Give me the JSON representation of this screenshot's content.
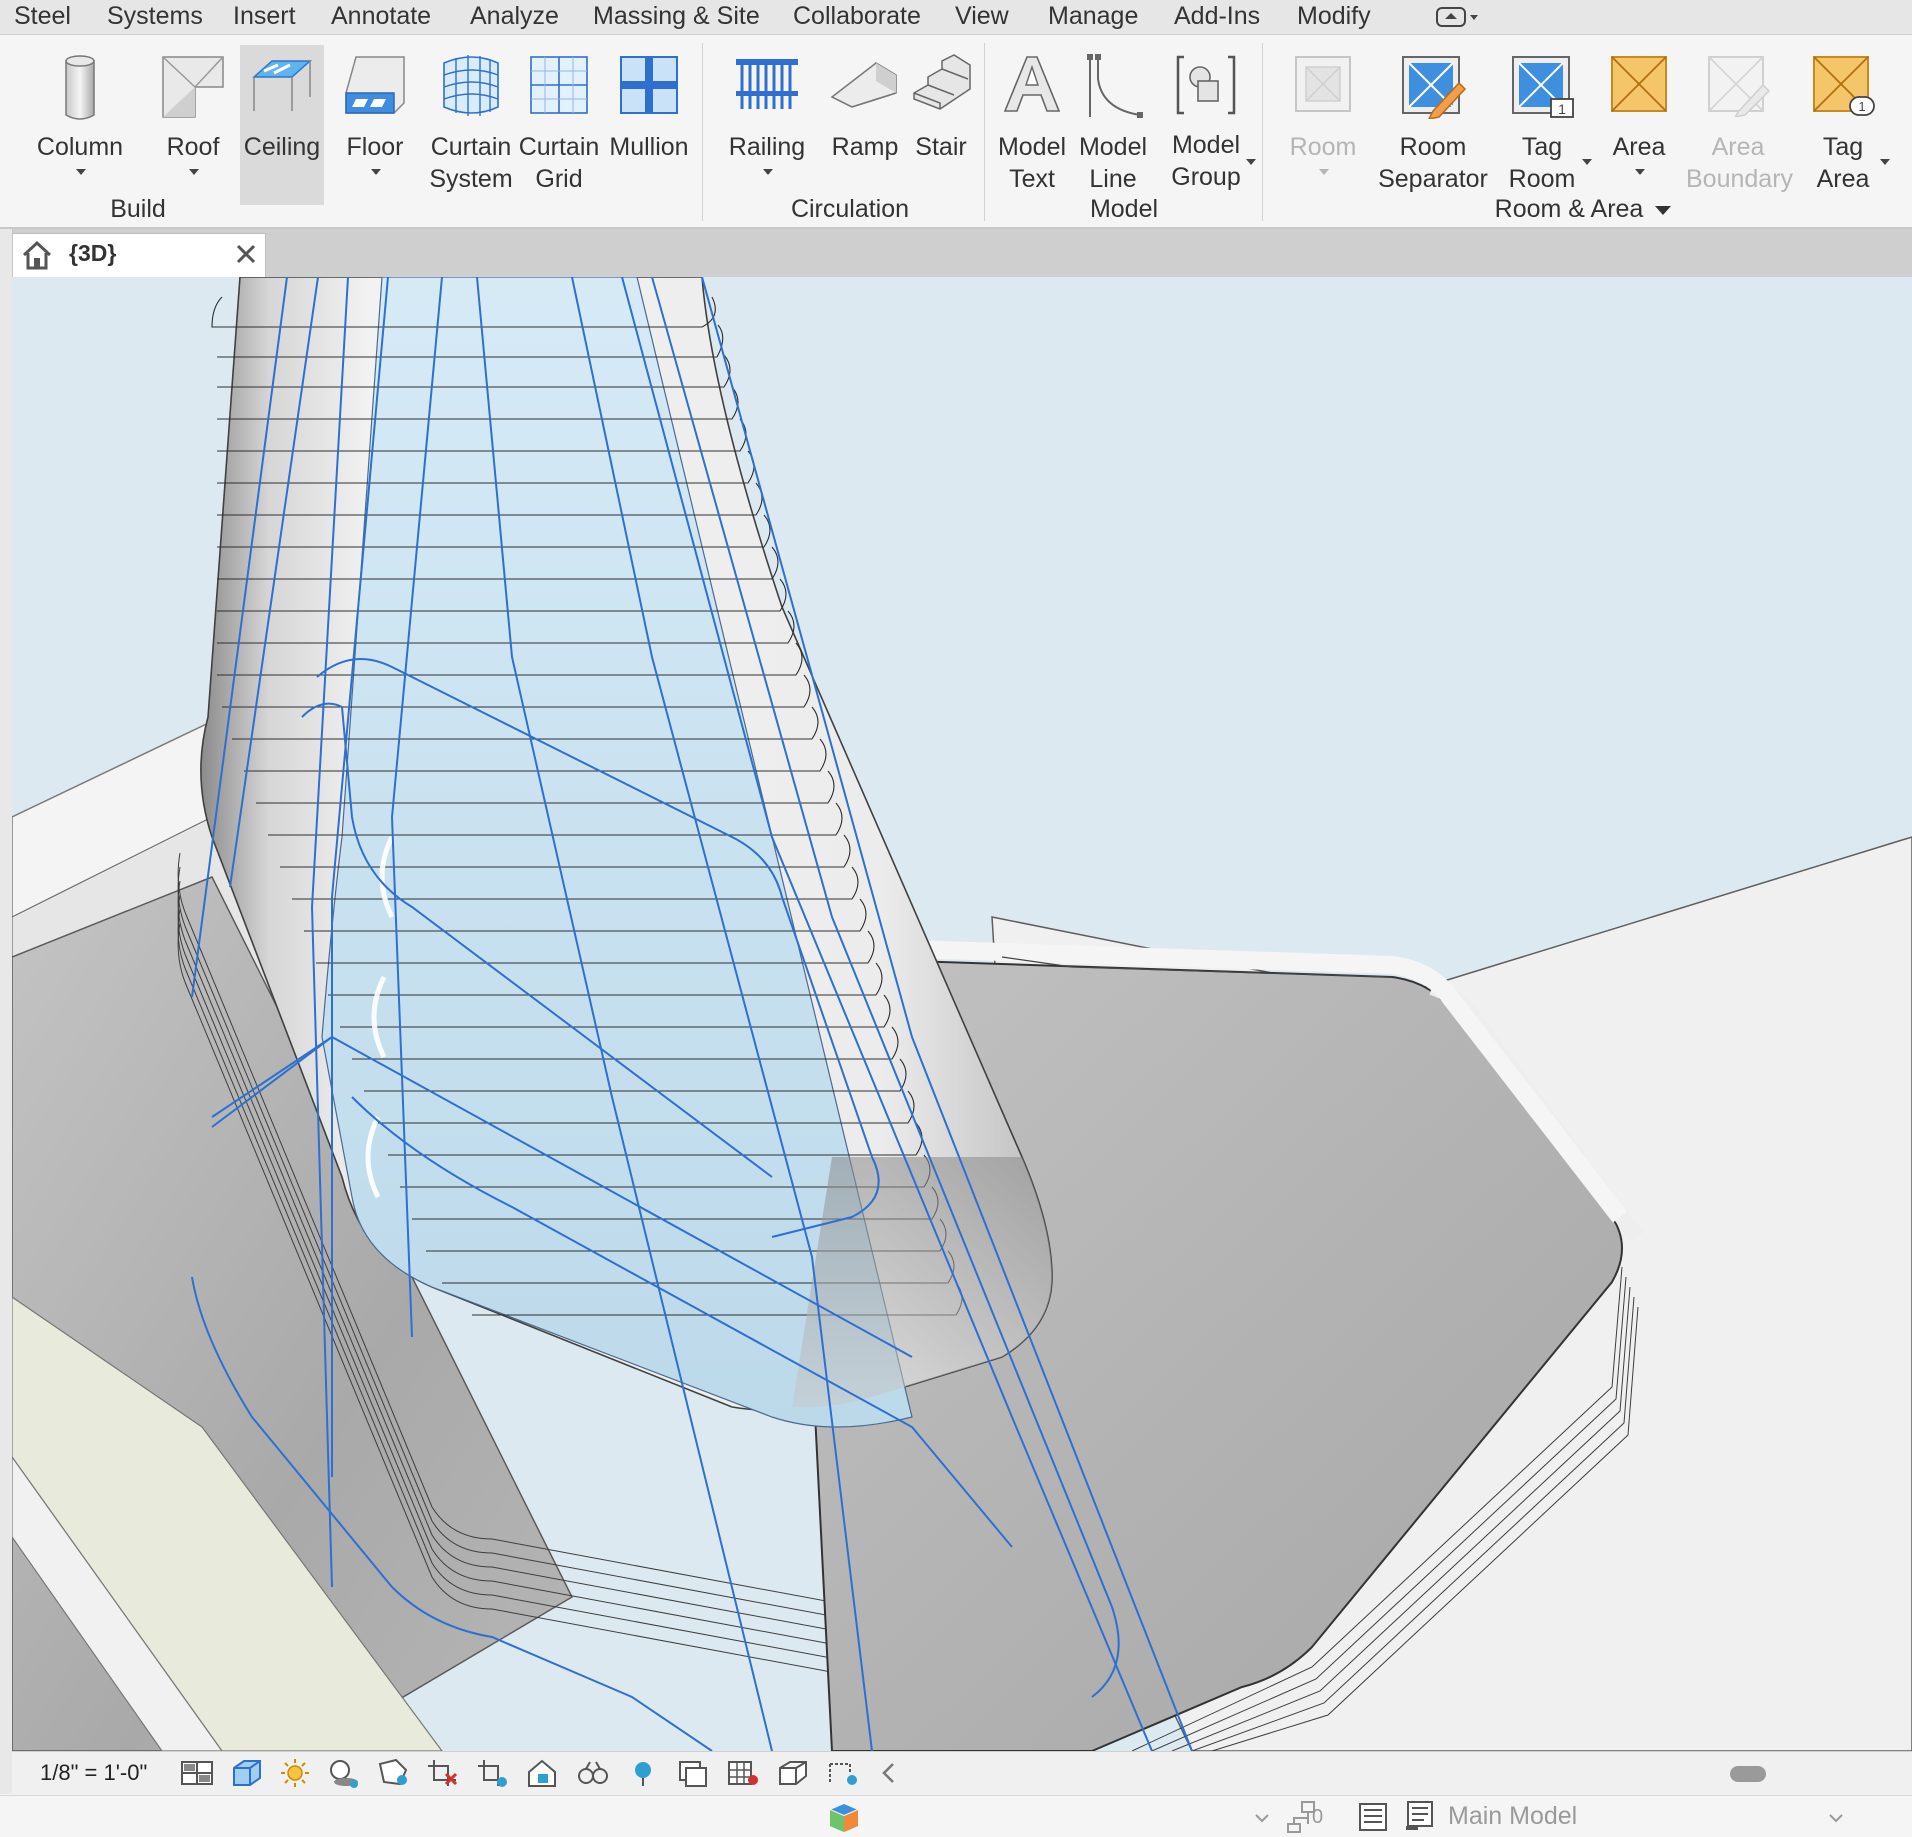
{
  "menu": {
    "tabs": [
      "Steel",
      "Systems",
      "Insert",
      "Annotate",
      "Analyze",
      "Massing & Site",
      "Collaborate",
      "View",
      "Manage",
      "Add-Ins",
      "Modify"
    ]
  },
  "ribbon": {
    "build": {
      "label": "Build",
      "tools": {
        "column": "Column",
        "roof": "Roof",
        "ceiling": "Ceiling",
        "floor": "Floor",
        "curtain_system_1": "Curtain",
        "curtain_system_2": "System",
        "curtain_grid_1": "Curtain",
        "curtain_grid_2": "Grid",
        "mullion": "Mullion"
      }
    },
    "circulation": {
      "label": "Circulation",
      "tools": {
        "railing": "Railing",
        "ramp": "Ramp",
        "stair": "Stair"
      }
    },
    "model": {
      "label": "Model",
      "tools": {
        "model_text_1": "Model",
        "model_text_2": "Text",
        "model_line_1": "Model",
        "model_line_2": "Line",
        "model_group_1": "Model",
        "model_group_2": "Group"
      }
    },
    "room_area": {
      "label": "Room & Area",
      "tools": {
        "room": "Room",
        "room_separator_1": "Room",
        "room_separator_2": "Separator",
        "tag_room_1": "Tag",
        "tag_room_2": "Room",
        "area": "Area",
        "area_boundary_1": "Area",
        "area_boundary_2": "Boundary",
        "tag_area_1": "Tag",
        "tag_area_2": "Area"
      }
    }
  },
  "view_tab": {
    "label": "{3D}"
  },
  "view_bar": {
    "scale": "1/8\" = 1'-0\""
  },
  "status_bar": {
    "worksharing_count": "0",
    "active_model": "Main Model"
  },
  "colors": {
    "viewport_bg": "#dde9f1",
    "accent_blue": "#2f6fd0",
    "area_orange": "#f5c56a"
  }
}
